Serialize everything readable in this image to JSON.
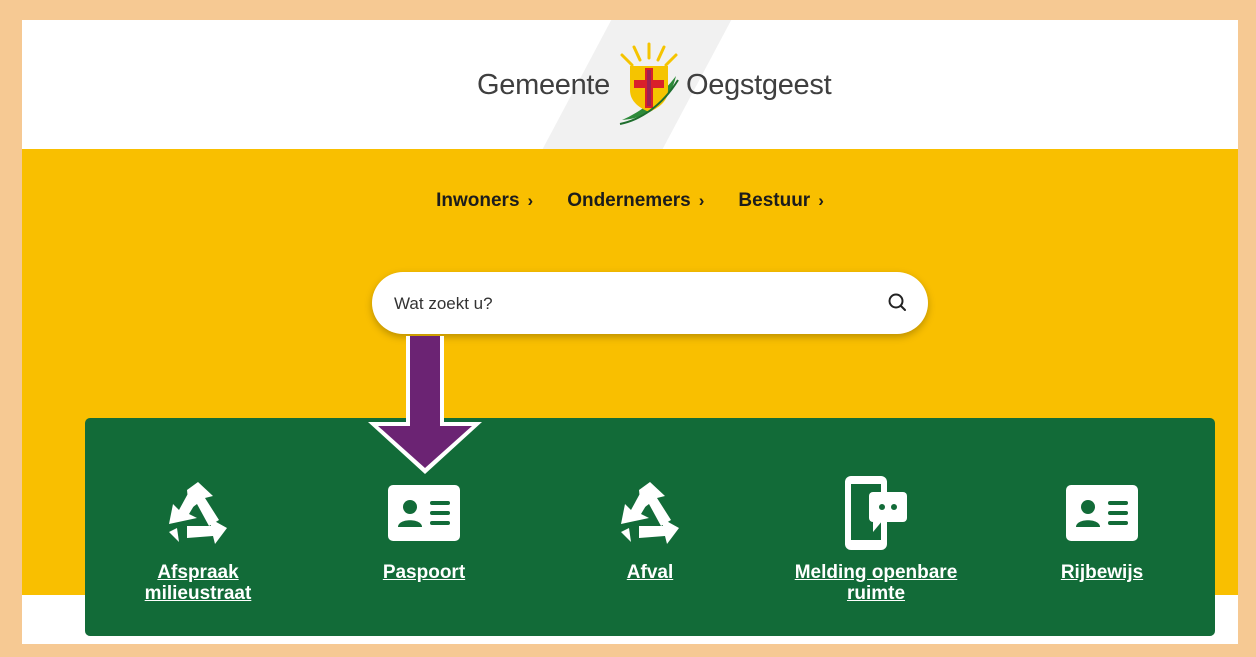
{
  "header": {
    "logo_left": "Gemeente",
    "logo_right": "Oegstgeest",
    "emblem_icon": "gemeente-oegstgeest-emblem"
  },
  "nav": {
    "items": [
      {
        "label": "Inwoners",
        "icon": "chevron-right-icon"
      },
      {
        "label": "Ondernemers",
        "icon": "chevron-right-icon"
      },
      {
        "label": "Bestuur",
        "icon": "chevron-right-icon"
      }
    ]
  },
  "search": {
    "placeholder": "Wat zoekt u?",
    "icon": "search-icon"
  },
  "tiles": [
    {
      "label": "Afspraak milieustraat",
      "icon": "recycle-icon"
    },
    {
      "label": "Paspoort",
      "icon": "id-card-icon"
    },
    {
      "label": "Afval",
      "icon": "recycle-icon"
    },
    {
      "label": "Melding openbare ruimte",
      "icon": "phone-message-icon"
    },
    {
      "label": "Rijbewijs",
      "icon": "id-card-icon"
    }
  ],
  "annotation": {
    "icon": "down-arrow-icon",
    "color": "#6b2373"
  },
  "colors": {
    "background": "#f6c993",
    "hero": "#f9bf00",
    "tiles": "#126b38"
  }
}
